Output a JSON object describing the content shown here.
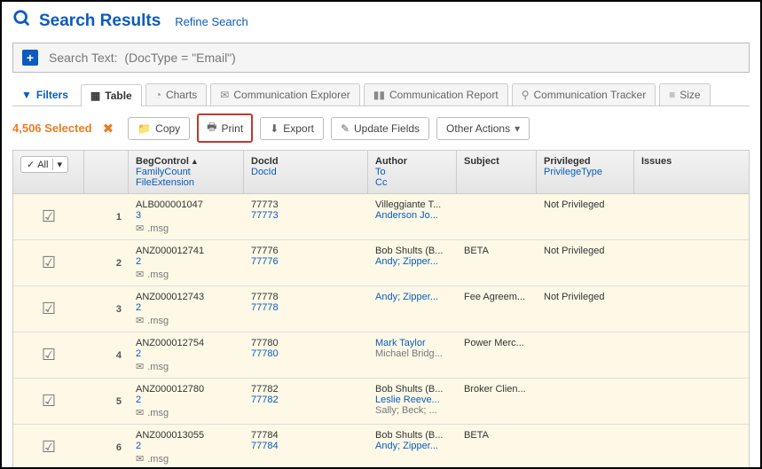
{
  "header": {
    "title": "Search Results",
    "refine": "Refine Search"
  },
  "search": {
    "label": "Search Text:",
    "query": "(DocType = \"Email\")"
  },
  "tabs": {
    "filters": "Filters",
    "table": "Table",
    "charts": "Charts",
    "comm_explorer": "Communication Explorer",
    "comm_report": "Communication Report",
    "comm_tracker": "Communication Tracker",
    "size": "Size"
  },
  "toolbar": {
    "selected": "4,506 Selected",
    "copy": "Copy",
    "print": "Print",
    "export": "Export",
    "update": "Update Fields",
    "other": "Other Actions"
  },
  "columns": {
    "all": "All",
    "beg": {
      "main": "BegControl",
      "sub1": "FamilyCount",
      "sub2": "FileExtension"
    },
    "docid": {
      "main": "DocId",
      "sub": "DocId"
    },
    "author": {
      "main": "Author",
      "sub1": "To",
      "sub2": "Cc"
    },
    "subject": "Subject",
    "priv": {
      "main": "Privileged",
      "sub": "PrivilegeType"
    },
    "issues": "Issues"
  },
  "rows": [
    {
      "num": "1",
      "beg": "ALB000001047",
      "fam": "3",
      "ext": ".msg",
      "docid": "77773",
      "docid2": "77773",
      "author": "Villeggiante T...",
      "to": "Anderson Jo...",
      "cc": "",
      "subject": "",
      "priv": "Not Privileged"
    },
    {
      "num": "2",
      "beg": "ANZ000012741",
      "fam": "2",
      "ext": ".msg",
      "docid": "77776",
      "docid2": "77776",
      "author": "Bob Shults (B...",
      "to": "Andy; Zipper...",
      "cc": "",
      "subject": "BETA",
      "priv": "Not Privileged"
    },
    {
      "num": "3",
      "beg": "ANZ000012743",
      "fam": "2",
      "ext": ".msg",
      "docid": "77778",
      "docid2": "77778",
      "author": "",
      "to": "Andy; Zipper...",
      "cc": "",
      "subject": "Fee Agreem...",
      "priv": "Not Privileged"
    },
    {
      "num": "4",
      "beg": "ANZ000012754",
      "fam": "2",
      "ext": ".msg",
      "docid": "77780",
      "docid2": "77780",
      "author": "",
      "to": "Mark Taylor",
      "cc": "Michael Bridg...",
      "subject": "Power Merc...",
      "priv": ""
    },
    {
      "num": "5",
      "beg": "ANZ000012780",
      "fam": "2",
      "ext": ".msg",
      "docid": "77782",
      "docid2": "77782",
      "author": "Bob Shults (B...",
      "to": "Leslie Reeve...",
      "cc": "Sally; Beck; ...",
      "subject": "Broker Clien...",
      "priv": ""
    },
    {
      "num": "6",
      "beg": "ANZ000013055",
      "fam": "2",
      "ext": ".msg",
      "docid": "77784",
      "docid2": "77784",
      "author": "Bob Shults (B...",
      "to": "Andy; Zipper...",
      "cc": "",
      "subject": "BETA",
      "priv": ""
    }
  ]
}
